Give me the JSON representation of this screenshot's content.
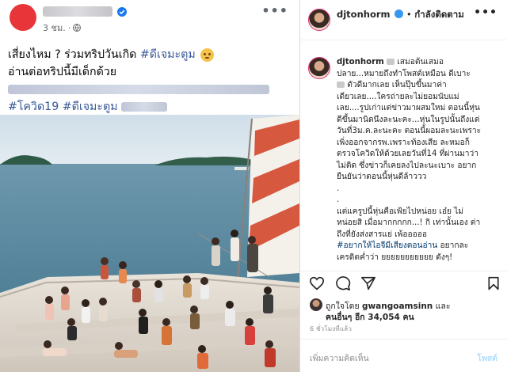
{
  "facebook_post": {
    "timestamp": "3 ชม.",
    "separator": "·",
    "more_label": "•••",
    "text_line1": "เสี่ยงไหม ? ร่วมทริปวันเกิด ",
    "hashtag_dj": "#ดีเจมะตูม",
    "text_line2": "อ่านต่อทริปนี้มีเด็กด้วย",
    "hashtag_covid": "#โควิด19",
    "hashtag_dj2": "#ดีเจมะตูม"
  },
  "instagram_post": {
    "username": "djtonhorm",
    "header_separator": "•",
    "follow_label": "กำลังติดตาม",
    "more_label": "•••",
    "caption_lines": [
      "เสมอต้นเสมอ",
      "ปลาย...หมายถึงทำโพสต์เหมือน ดีเบาะ",
      "ตัวดีมากเลย เห็นปุ๊บขึ้นมาค่า",
      "เดียวเลย....ใครถ่ายละไม่ยอมนับแม่",
      "เลย....รูปเก่าแต่ข่าวมาผสมใหม่ ตอนนี้หุ่น",
      "ดีขึ้นมานิดนึงละนะคะ...หุ่นในรูปนั้นถึงแต่",
      "วันที่3ม.ค.ละนะคะ ตอนนี้ผอมละนะเพราะ",
      "เพิ่งออกจากรพ.เพราะท้องเสีย ละหมอก็",
      "ตรวจโควิดให้ด้วยเลยวันที่14 ที่ผ่านมาว่า",
      "ไม่ติด ซึ่งข่าวก็เคยลงไปละนะเบาะ อยาก",
      "ยืนยันว่าตอนนี้หุ่นดีล้าววว"
    ],
    "caption_dot1": ".",
    "caption_dot2": ".",
    "caption_line_b1": "แต่แครูปนี้หุ่นคือเฟ้ยไปหน่อย เอ๋ย ไม่",
    "caption_line_b2": "หน่อยสิ เมื่อมากกกกก...! กิ เท่านั้นเอง ต่า",
    "caption_line_b3": "ถึงที่ยังส่งสารแย่ เพ้อออออ",
    "caption_tag": "#อยากให้ไอจีมีเสียงตอนอ่าน",
    "caption_line_b4_rest": " อยากละ",
    "caption_line_b5": "เครดิตค่ำว่า ยยยยยยยยยยย ดังๆ!",
    "liked_by_prefix": "ถูกใจโดย ",
    "liked_by_user": "gwangoamsinn",
    "liked_by_and": " และ",
    "others_label": "คนอื่นๆ อีก 34,054 คน",
    "time_ago": "6 ชั่วโมงที่แล้ว",
    "comment_placeholder": "เพิ่มความคิดเห็น",
    "post_label": "โพสต์"
  },
  "icons": [
    "verified-badge-icon",
    "globe-icon",
    "more-icon",
    "heart-icon",
    "comment-icon",
    "share-icon",
    "bookmark-icon"
  ],
  "colors": {
    "facebook_hashtag": "#385898",
    "instagram_tag": "#00376b",
    "facebook_verified": "#1877f2",
    "instagram_verified": "#3897f0",
    "post_button": "#b2dffc"
  }
}
